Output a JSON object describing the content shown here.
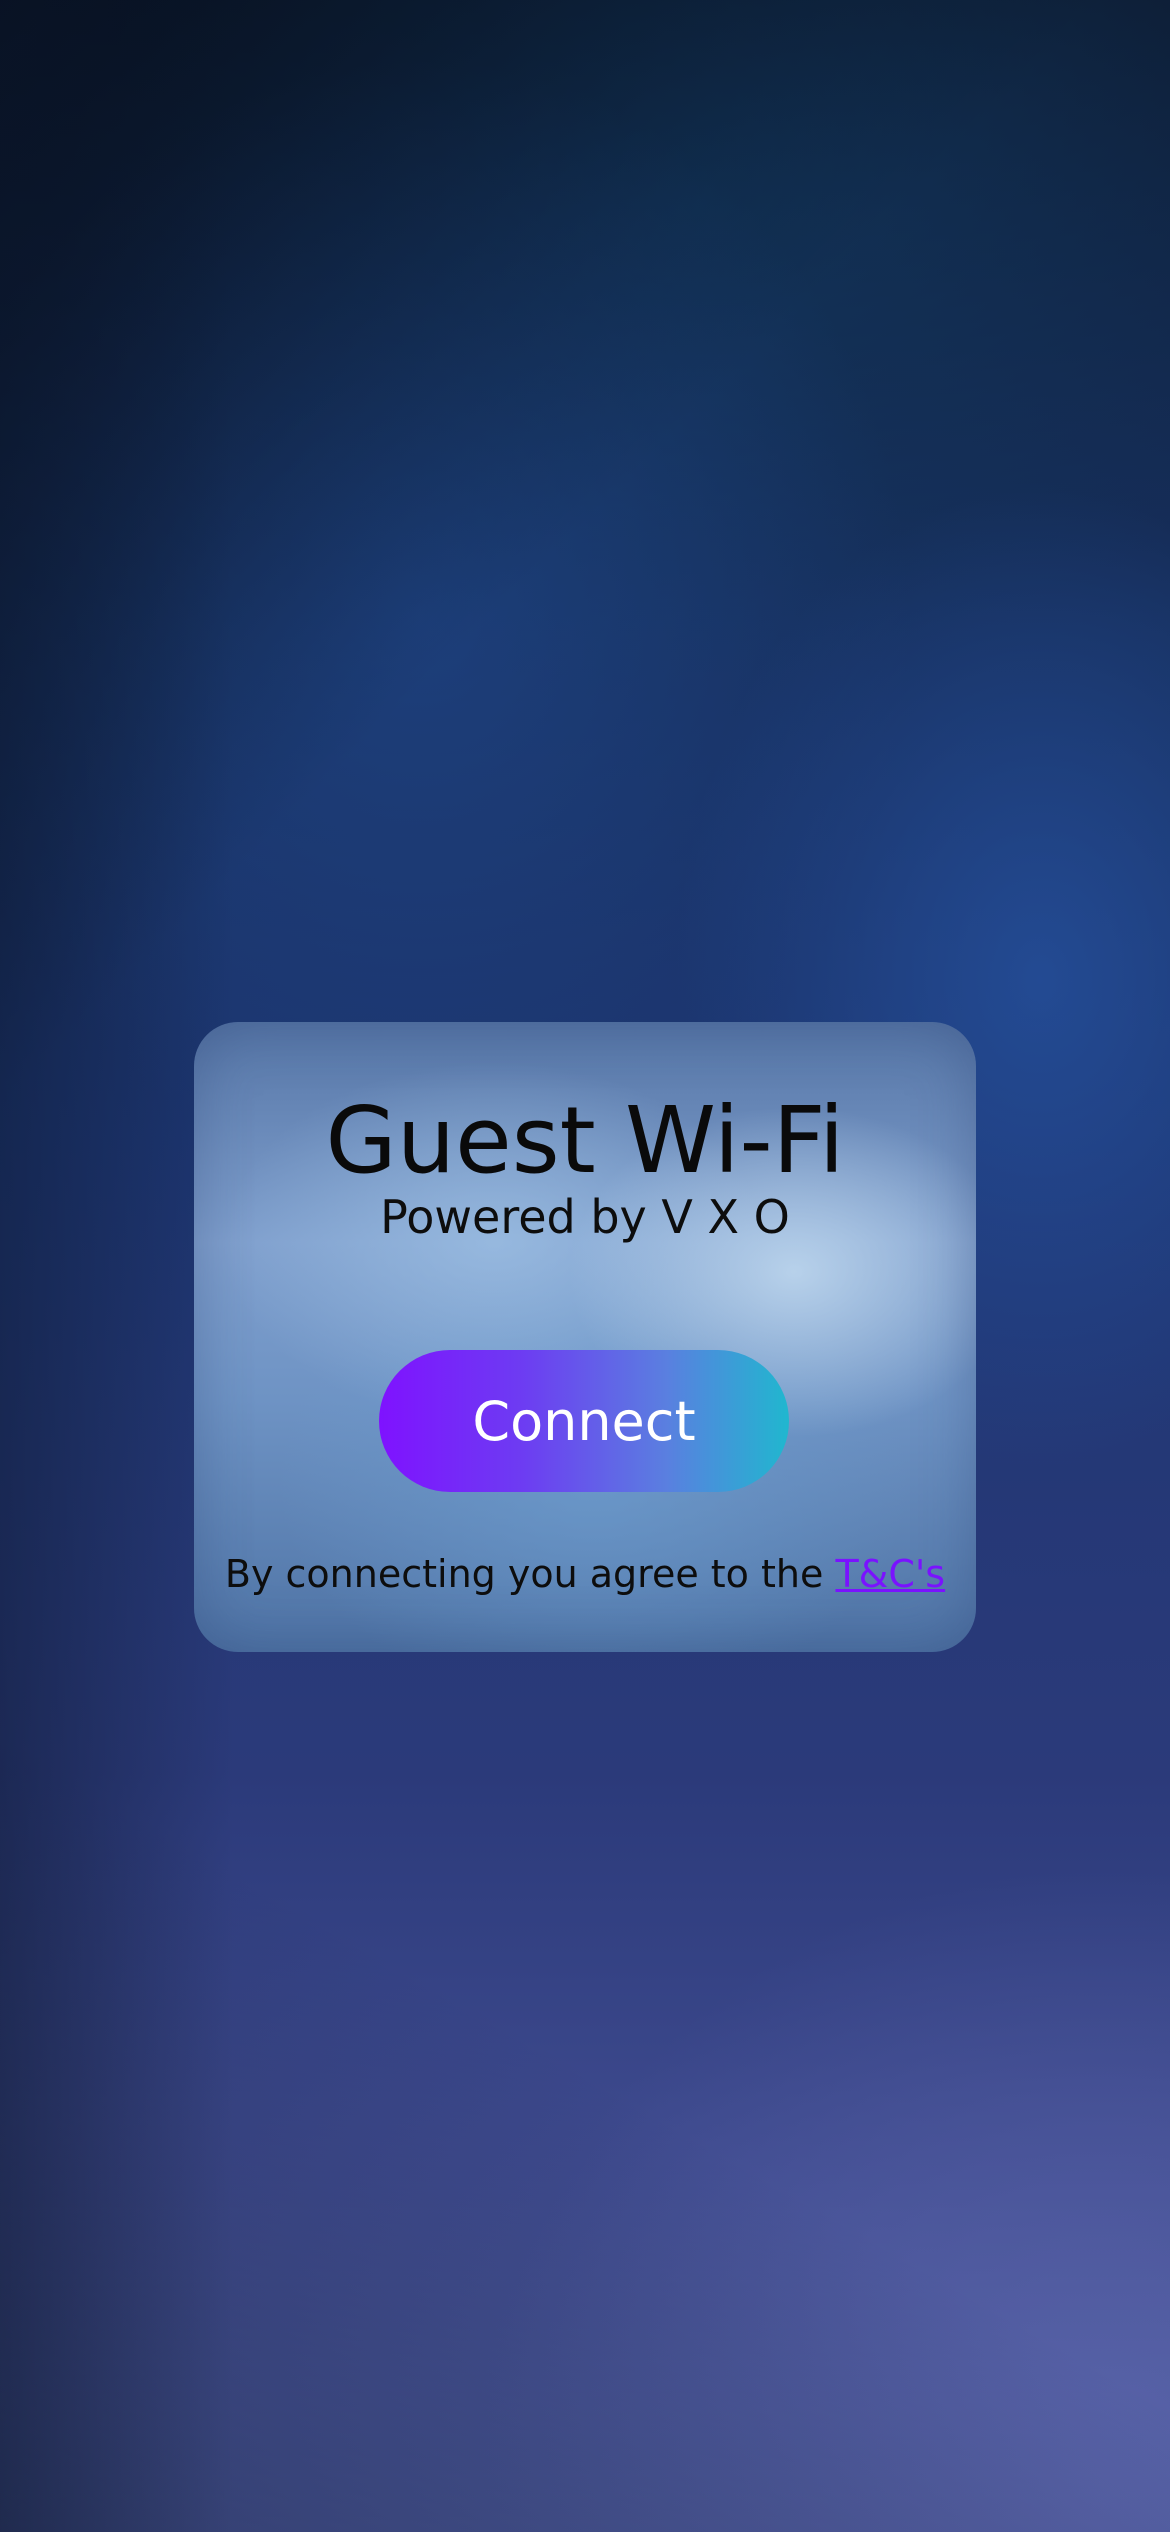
{
  "portal": {
    "title": "Guest Wi-Fi",
    "subtitle": "Powered by V X O",
    "connect_label": "Connect",
    "agreement_text": "By connecting you agree to the",
    "terms_link_label": "T&C's"
  },
  "colors": {
    "button_gradient_start": "#7f12ff",
    "button_gradient_end": "#20b7cf",
    "link": "#7a12ff",
    "background": "#1c2f63"
  }
}
